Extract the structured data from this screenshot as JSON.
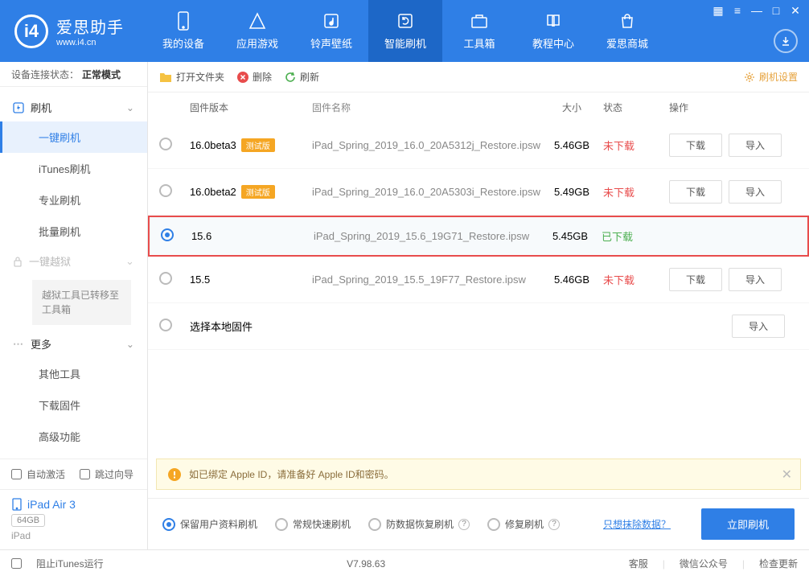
{
  "brand": {
    "cn": "爱思助手",
    "url": "www.i4.cn",
    "logo_letter": "i4"
  },
  "nav": [
    {
      "label": "我的设备"
    },
    {
      "label": "应用游戏"
    },
    {
      "label": "铃声壁纸"
    },
    {
      "label": "智能刷机"
    },
    {
      "label": "工具箱"
    },
    {
      "label": "教程中心"
    },
    {
      "label": "爱思商城"
    }
  ],
  "sidebar": {
    "conn_label": "设备连接状态：",
    "conn_value": "正常模式",
    "flash_head": "刷机",
    "items": [
      "一键刷机",
      "iTunes刷机",
      "专业刷机",
      "批量刷机"
    ],
    "jb_head": "一键越狱",
    "jb_note": "越狱工具已转移至工具箱",
    "more_head": "更多",
    "more_items": [
      "其他工具",
      "下载固件",
      "高级功能"
    ],
    "auto_activate": "自动激活",
    "skip_guide": "跳过向导",
    "device": {
      "name": "iPad Air 3",
      "capacity": "64GB",
      "type": "iPad"
    }
  },
  "toolbar": {
    "open_folder": "打开文件夹",
    "delete": "删除",
    "refresh": "刷新",
    "settings": "刷机设置"
  },
  "table": {
    "headers": {
      "version": "固件版本",
      "name": "固件名称",
      "size": "大小",
      "status": "状态",
      "ops": "操作"
    },
    "btn_download": "下载",
    "btn_import": "导入",
    "status_not_downloaded": "未下载",
    "status_downloaded": "已下载",
    "select_local": "选择本地固件",
    "rows": [
      {
        "version": "16.0beta3",
        "beta": "测试版",
        "name": "iPad_Spring_2019_16.0_20A5312j_Restore.ipsw",
        "size": "5.46GB",
        "status": "nd"
      },
      {
        "version": "16.0beta2",
        "beta": "测试版",
        "name": "iPad_Spring_2019_16.0_20A5303i_Restore.ipsw",
        "size": "5.49GB",
        "status": "nd"
      },
      {
        "version": "15.6",
        "name": "iPad_Spring_2019_15.6_19G71_Restore.ipsw",
        "size": "5.45GB",
        "status": "dl",
        "selected": true
      },
      {
        "version": "15.5",
        "name": "iPad_Spring_2019_15.5_19F77_Restore.ipsw",
        "size": "5.46GB",
        "status": "nd"
      }
    ]
  },
  "notice": "如已绑定 Apple ID，请准备好 Apple ID和密码。",
  "flash": {
    "opts": [
      "保留用户资料刷机",
      "常规快速刷机",
      "防数据恢复刷机",
      "修复刷机"
    ],
    "erase_link": "只想抹除数据？",
    "go": "立即刷机"
  },
  "statusbar": {
    "block_itunes": "阻止iTunes运行",
    "version": "V7.98.63",
    "items": [
      "客服",
      "微信公众号",
      "检查更新"
    ]
  }
}
